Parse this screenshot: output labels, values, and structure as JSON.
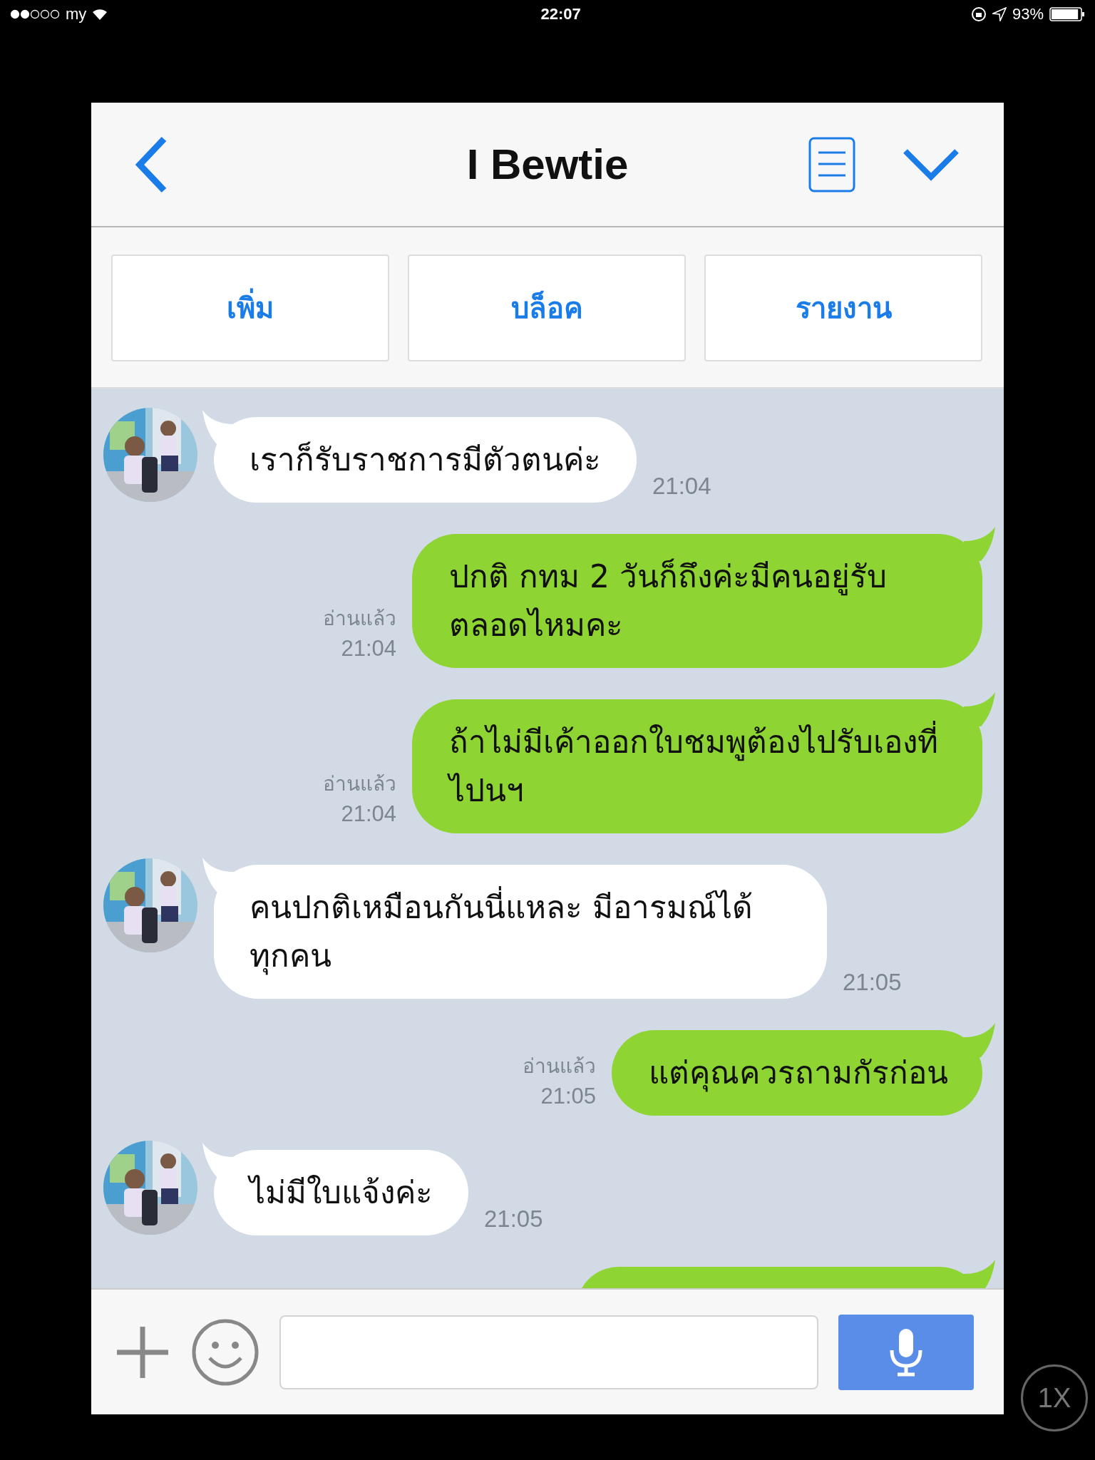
{
  "status_bar": {
    "carrier": "my",
    "time": "22:07",
    "battery": "93%"
  },
  "header": {
    "title": "I Bewtie"
  },
  "actions": [
    {
      "label": "เพิ่ม"
    },
    {
      "label": "บล็อค"
    },
    {
      "label": "รายงาน"
    }
  ],
  "messages": [
    {
      "kind": "incoming",
      "text": "เราก็รับราชการมีตัวตนค่ะ",
      "time": "21:04"
    },
    {
      "kind": "outgoing",
      "text": "ปกติ กทม 2 วันก็ถึงค่ะมีคนอยู่รับตลอดไหมคะ",
      "time": "21:04",
      "read_label": "อ่านแล้ว"
    },
    {
      "kind": "outgoing",
      "text": "ถ้าไม่มีเค้าออกใบชมพูต้องไปรับเองที่ไปนฯ",
      "time": "21:04",
      "read_label": "อ่านแล้ว"
    },
    {
      "kind": "incoming",
      "text": "คนปกติเหมือนกันนี่แหละ มีอารมณ์ได้ทุกคน",
      "time": "21:05"
    },
    {
      "kind": "outgoing",
      "text": "แต่คุณควรถามกัรก่อน",
      "time": "21:05",
      "read_label": "อ่านแล้ว"
    },
    {
      "kind": "incoming",
      "text": "ไม่มีใบแจ้งค่ะ",
      "time": "21:05"
    }
  ],
  "zoom_badge": "1X"
}
